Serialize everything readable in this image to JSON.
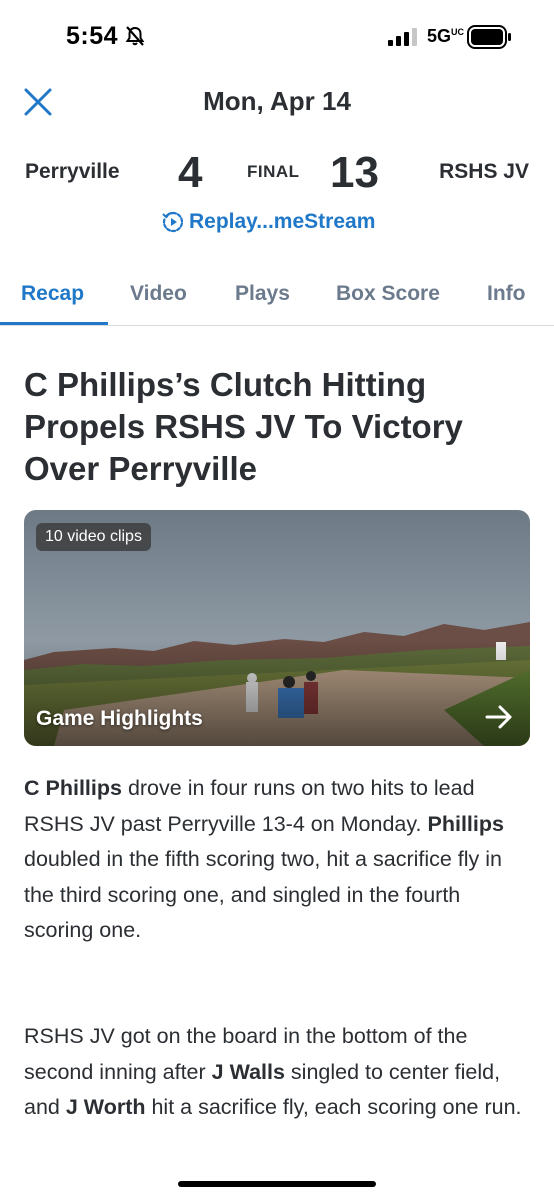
{
  "status_bar": {
    "time": "5:54",
    "network": "5G",
    "network_suffix": "UC",
    "icons": [
      "bell-slash-icon",
      "signal-icon",
      "battery-icon"
    ]
  },
  "header": {
    "close_icon": "close-icon",
    "date": "Mon, Apr 14"
  },
  "scoreboard": {
    "away_team": "Perryville",
    "away_score": "4",
    "status": "FINAL",
    "home_score": "13",
    "home_team": "RSHS JV",
    "replay_label": "Replay...meStream",
    "replay_icon": "replay-icon"
  },
  "tabs": [
    {
      "label": "Recap",
      "active": true
    },
    {
      "label": "Video",
      "active": false
    },
    {
      "label": "Plays",
      "active": false
    },
    {
      "label": "Box Score",
      "active": false
    },
    {
      "label": "Info",
      "active": false
    }
  ],
  "article": {
    "headline": "C Phillips’s Clutch Hitting Propels RSHS JV To Victory Over Perryville",
    "video": {
      "badge": "10 video clips",
      "title": "Game Highlights",
      "arrow_icon": "arrow-right-icon"
    },
    "paragraphs": [
      [
        {
          "text": "C Phillips",
          "bold": true
        },
        {
          "text": " drove in four runs on two hits to lead RSHS JV past Perryville 13-4 on Monday. ",
          "bold": false
        },
        {
          "text": "Phillips",
          "bold": true
        },
        {
          "text": " doubled in the fifth scoring two, hit a sacrifice fly in the third scoring one, and singled in the fourth scoring one.",
          "bold": false
        }
      ],
      [
        {
          "text": "RSHS JV got on the board in the bottom of the second inning after ",
          "bold": false
        },
        {
          "text": "J Walls",
          "bold": true
        },
        {
          "text": " singled to center field, and ",
          "bold": false
        },
        {
          "text": "J Worth",
          "bold": true
        },
        {
          "text": " hit a sacrifice fly, each scoring one run.",
          "bold": false
        }
      ]
    ]
  },
  "colors": {
    "accent": "#1f78c8",
    "text": "#2b2f33",
    "tab_inactive": "#6b7a8c"
  }
}
